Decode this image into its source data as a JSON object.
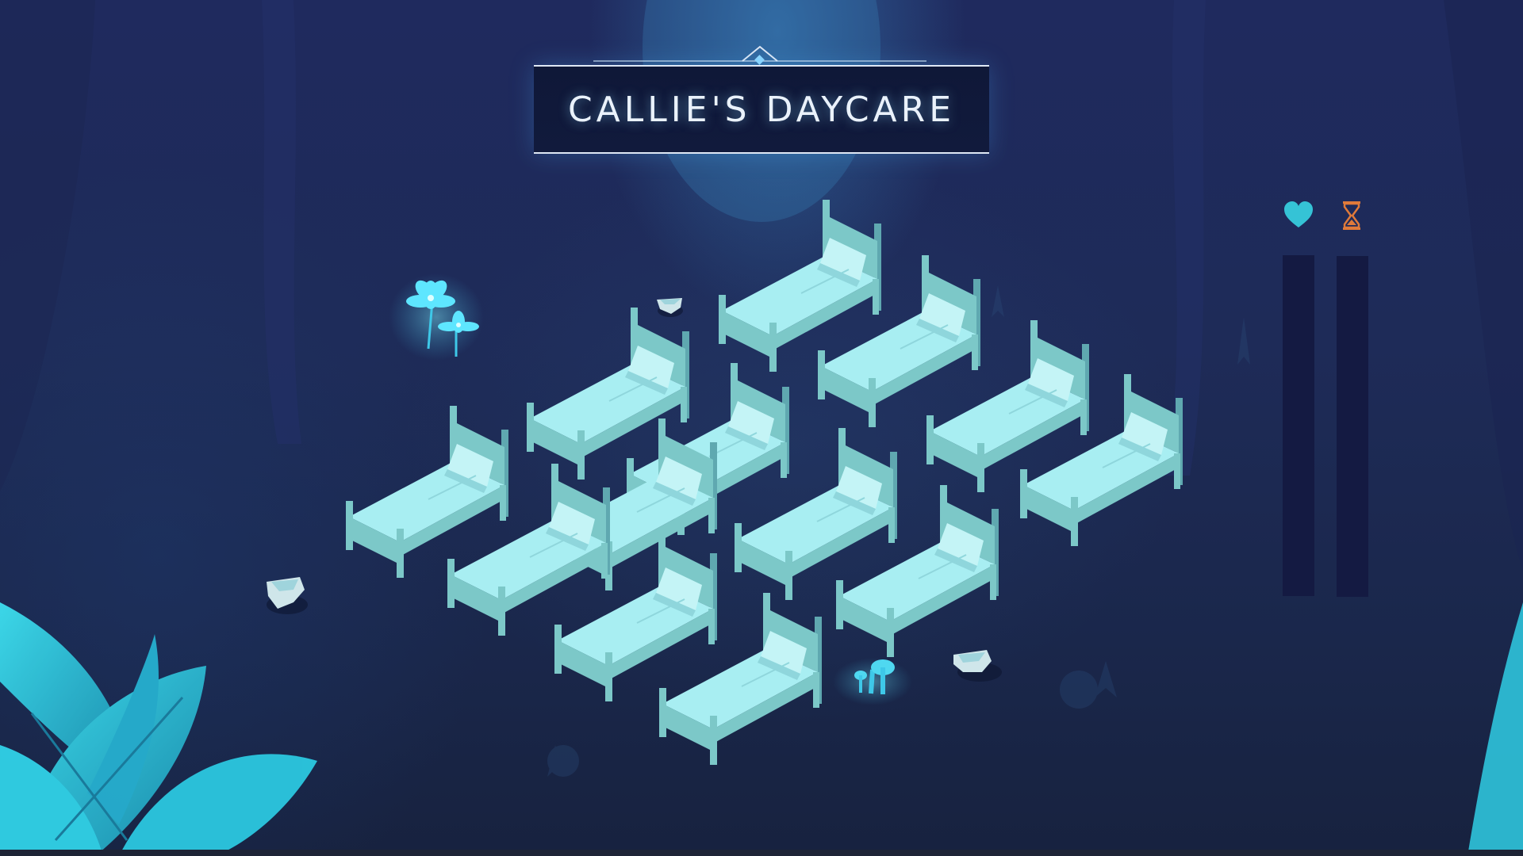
{
  "title": "CALLIE'S DAYCARE",
  "meters": {
    "love": {
      "icon": "heart-icon",
      "color": "#35c3d6",
      "fill_fraction": 0
    },
    "time": {
      "icon": "hourglass-icon",
      "color": "#e07a3a",
      "fill_fraction": 0
    }
  },
  "beds": [
    {
      "id": "bed-1",
      "occupied": false
    },
    {
      "id": "bed-2",
      "occupied": false
    },
    {
      "id": "bed-3",
      "occupied": false
    },
    {
      "id": "bed-4",
      "occupied": false
    },
    {
      "id": "bed-5",
      "occupied": false
    },
    {
      "id": "bed-6",
      "occupied": false
    },
    {
      "id": "bed-7",
      "occupied": false
    },
    {
      "id": "bed-8",
      "occupied": false
    },
    {
      "id": "bed-9",
      "occupied": false
    },
    {
      "id": "bed-10",
      "occupied": false
    },
    {
      "id": "bed-11",
      "occupied": false
    },
    {
      "id": "bed-12",
      "occupied": false
    },
    {
      "id": "bed-13",
      "occupied": false
    }
  ],
  "colors": {
    "background": "#1c2550",
    "bed_sheet": "#a8eef2",
    "bed_frame": "#7cc8c8",
    "glow": "#4fd8ff"
  }
}
